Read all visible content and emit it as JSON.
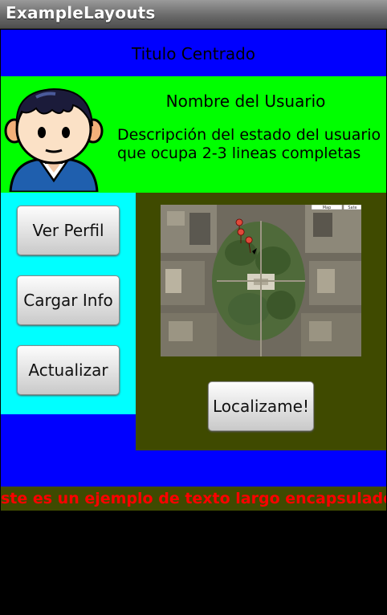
{
  "app": {
    "title": "ExampleLayouts"
  },
  "header": {
    "title": "Titulo Centrado"
  },
  "user": {
    "name": "Nombre del Usuario",
    "description": "Descripción del estado del usuario que ocupa 2-3 lineas completas"
  },
  "buttons": {
    "ver_perfil": "Ver Perfil",
    "cargar_info": "Cargar Info",
    "actualizar": "Actualizar",
    "localizame": "Localizame!"
  },
  "map": {
    "controls": [
      "Map",
      "Sate"
    ]
  },
  "marquee": {
    "text": "Este es un ejemplo de texto largo encapsulado en un TextView"
  },
  "colors": {
    "header_bg": "#0000ff",
    "profile_bg": "#00ff00",
    "buttons_panel_bg": "#00ffff",
    "map_panel_bg": "#3f4a00",
    "marquee_text": "#ff0000"
  }
}
